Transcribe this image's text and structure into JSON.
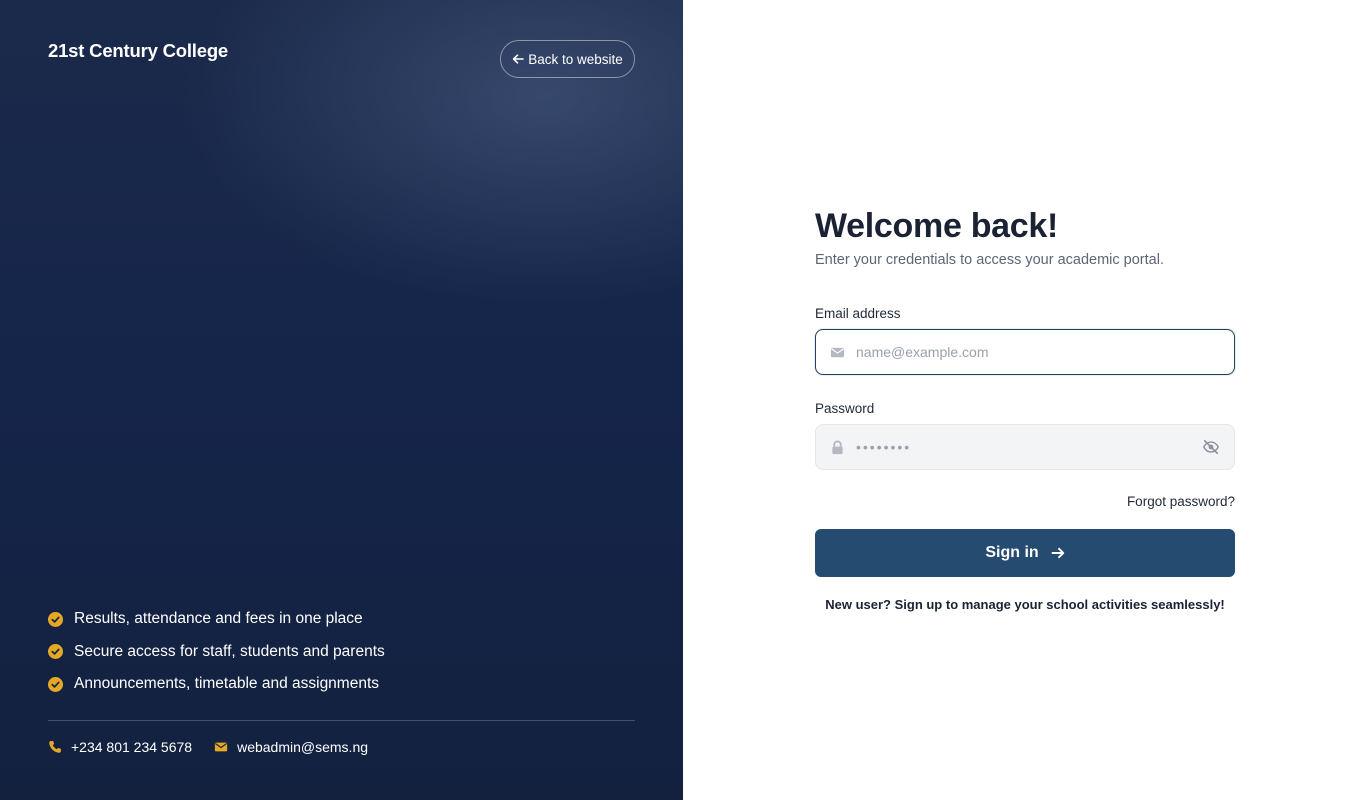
{
  "brand": {
    "name": "21st Century College"
  },
  "nav": {
    "back_label": "Back to website"
  },
  "features": [
    {
      "text": "Results, attendance and fees in one place",
      "icon": "check-circle-icon"
    },
    {
      "text": "Secure access for staff, students and parents",
      "icon": "check-circle-icon"
    },
    {
      "text": "Announcements, timetable and assignments",
      "icon": "check-circle-icon"
    }
  ],
  "contact": {
    "phone": "+234 801 234 5678",
    "email": "webadmin@sems.ng"
  },
  "login": {
    "title": "Welcome back!",
    "subtitle": "Enter your credentials to access your academic portal.",
    "email_label": "Email address",
    "email_placeholder": "name@example.com",
    "email_value": "",
    "password_label": "Password",
    "password_placeholder": "••••••••",
    "password_value": "",
    "forgot_label": "Forgot password?",
    "submit_label": "Sign in",
    "signup_text": "New user? Sign up to manage your school activities seamlessly!"
  },
  "colors": {
    "panel_dark": "#15254a",
    "accent_gold": "#e5a823",
    "primary_button": "#264b70",
    "input_focus_border": "#1f3f63"
  }
}
